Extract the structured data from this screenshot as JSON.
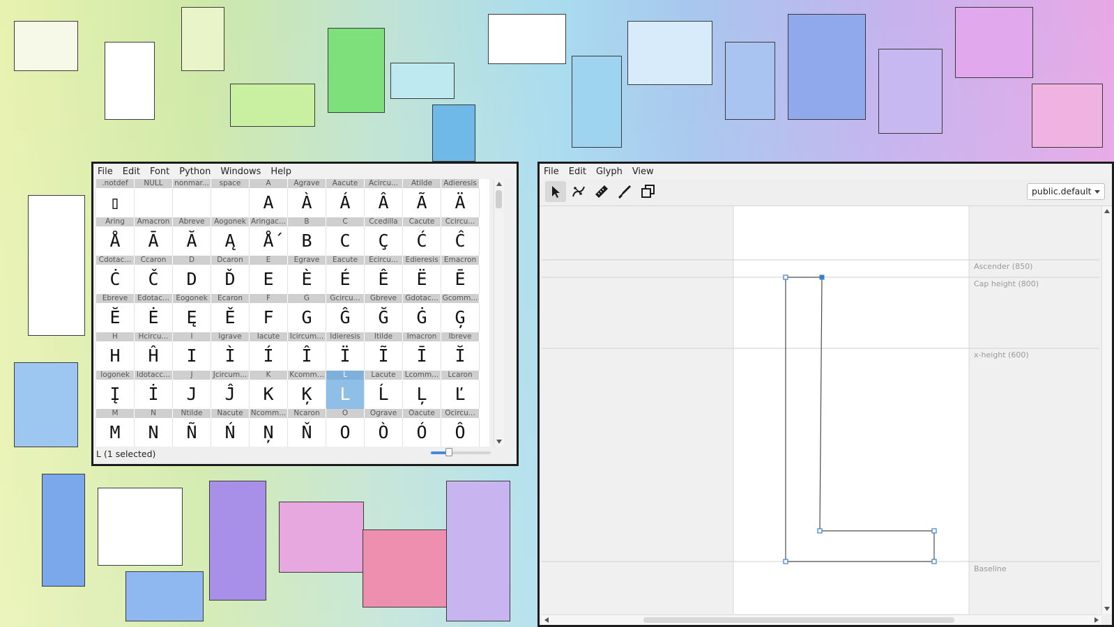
{
  "font_window": {
    "menu": [
      "File",
      "Edit",
      "Font",
      "Python",
      "Windows",
      "Help"
    ],
    "glyphs": [
      {
        "name": ".notdef",
        "char": "▯"
      },
      {
        "name": "NULL",
        "char": ""
      },
      {
        "name": "nonmar...",
        "char": ""
      },
      {
        "name": "space",
        "char": ""
      },
      {
        "name": "A",
        "char": "A"
      },
      {
        "name": "Agrave",
        "char": "À"
      },
      {
        "name": "Aacute",
        "char": "Á"
      },
      {
        "name": "Acircu...",
        "char": "Â"
      },
      {
        "name": "Atilde",
        "char": "Ã"
      },
      {
        "name": "Adieresis",
        "char": "Ä"
      },
      {
        "name": "Aring",
        "char": "Å"
      },
      {
        "name": "Amacron",
        "char": "Ā"
      },
      {
        "name": "Abreve",
        "char": "Ă"
      },
      {
        "name": "Aogonek",
        "char": "Ą"
      },
      {
        "name": "Aringac...",
        "char": "Ǻ"
      },
      {
        "name": "B",
        "char": "B"
      },
      {
        "name": "C",
        "char": "C"
      },
      {
        "name": "Ccedilla",
        "char": "Ç"
      },
      {
        "name": "Cacute",
        "char": "Ć"
      },
      {
        "name": "Ccircu...",
        "char": "Ĉ"
      },
      {
        "name": "Cdotac...",
        "char": "Ċ"
      },
      {
        "name": "Ccaron",
        "char": "Č"
      },
      {
        "name": "D",
        "char": "D"
      },
      {
        "name": "Dcaron",
        "char": "Ď"
      },
      {
        "name": "E",
        "char": "E"
      },
      {
        "name": "Egrave",
        "char": "È"
      },
      {
        "name": "Eacute",
        "char": "É"
      },
      {
        "name": "Ecircu...",
        "char": "Ê"
      },
      {
        "name": "Edieresis",
        "char": "Ë"
      },
      {
        "name": "Emacron",
        "char": "Ē"
      },
      {
        "name": "Ebreve",
        "char": "Ĕ"
      },
      {
        "name": "Edotac...",
        "char": "Ė"
      },
      {
        "name": "Eogonek",
        "char": "Ę"
      },
      {
        "name": "Ecaron",
        "char": "Ě"
      },
      {
        "name": "F",
        "char": "F"
      },
      {
        "name": "G",
        "char": "G"
      },
      {
        "name": "Gcircu...",
        "char": "Ĝ"
      },
      {
        "name": "Gbreve",
        "char": "Ğ"
      },
      {
        "name": "Gdotac...",
        "char": "Ġ"
      },
      {
        "name": "Gcomm...",
        "char": "Ģ"
      },
      {
        "name": "H",
        "char": "H"
      },
      {
        "name": "Hcircu...",
        "char": "Ĥ"
      },
      {
        "name": "I",
        "char": "I"
      },
      {
        "name": "Igrave",
        "char": "Ì"
      },
      {
        "name": "Iacute",
        "char": "Í"
      },
      {
        "name": "Icircum...",
        "char": "Î"
      },
      {
        "name": "Idieresis",
        "char": "Ï"
      },
      {
        "name": "Itilde",
        "char": "Ĩ"
      },
      {
        "name": "Imacron",
        "char": "Ī"
      },
      {
        "name": "Ibreve",
        "char": "Ĭ"
      },
      {
        "name": "Iogonek",
        "char": "Į"
      },
      {
        "name": "Idotacc...",
        "char": "İ"
      },
      {
        "name": "J",
        "char": "J"
      },
      {
        "name": "Jcircum...",
        "char": "Ĵ"
      },
      {
        "name": "K",
        "char": "K"
      },
      {
        "name": "Kcomm...",
        "char": "Ķ"
      },
      {
        "name": "L",
        "char": "L",
        "selected": true
      },
      {
        "name": "Lacute",
        "char": "Ĺ"
      },
      {
        "name": "Lcomm...",
        "char": "Ļ"
      },
      {
        "name": "Lcaron",
        "char": "Ľ"
      },
      {
        "name": "M",
        "char": "M"
      },
      {
        "name": "N",
        "char": "N"
      },
      {
        "name": "Ntilde",
        "char": "Ñ"
      },
      {
        "name": "Nacute",
        "char": "Ń"
      },
      {
        "name": "Ncomm...",
        "char": "Ņ"
      },
      {
        "name": "Ncaron",
        "char": "Ň"
      },
      {
        "name": "O",
        "char": "O"
      },
      {
        "name": "Ograve",
        "char": "Ò"
      },
      {
        "name": "Oacute",
        "char": "Ó"
      },
      {
        "name": "Ocircu...",
        "char": "Ô"
      }
    ],
    "status": "L (1 selected)",
    "zoom_fraction": 0.3
  },
  "glyph_window": {
    "menu": [
      "File",
      "Edit",
      "Glyph",
      "View"
    ],
    "tools": [
      "selection-tool",
      "pen-tool",
      "ruler-tool",
      "knife-tool",
      "components-tool"
    ],
    "layer": "public.default",
    "metrics": {
      "ascender": "Ascender (850)",
      "cap_height": "Cap height (800)",
      "x_height": "x-height (600)",
      "baseline": "Baseline"
    },
    "accent_color": "#3b7fc4"
  }
}
